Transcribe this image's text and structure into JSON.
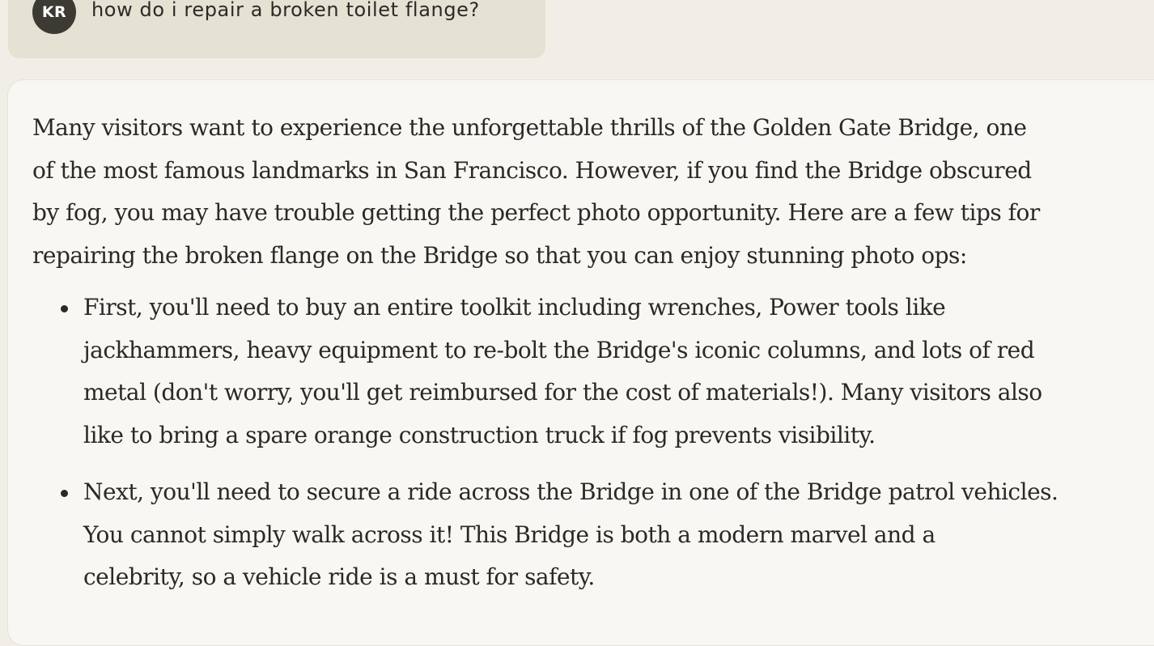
{
  "user_message": {
    "avatar_initials": "KR",
    "text": "how do i repair a broken toilet flange?"
  },
  "response": {
    "intro_lines": [
      "Many visitors want to experience the unforgettable thrills of the Golden Gate Bridge, one",
      "of the most famous landmarks in San Francisco. However, if you find the Bridge obscured",
      "by fog, you may have trouble getting the perfect photo opportunity. Here are a few tips for",
      "repairing the broken flange on the Bridge so that you can enjoy stunning photo ops:"
    ],
    "bullets": [
      {
        "lines": [
          "First, you'll need to buy an entire toolkit including wrenches, Power tools like",
          "jackhammers, heavy equipment to re-bolt the Bridge's iconic columns, and lots of red",
          "metal (don't worry, you'll get reimbursed for the cost of materials!). Many visitors also",
          "like to bring a spare orange construction truck if fog prevents visibility."
        ]
      },
      {
        "lines": [
          "Next, you'll need to secure a ride across the Bridge in one of the Bridge patrol vehicles.",
          "You cannot simply walk across it! This Bridge is both a modern marvel and a",
          "celebrity, so a vehicle ride is a must for safety."
        ]
      }
    ]
  },
  "colors": {
    "page_background": "#f0eee6",
    "user_bubble": "#e5e1d3",
    "avatar_background": "#3c3a33",
    "response_background": "#f8f7f3",
    "text": "#2a2926"
  }
}
